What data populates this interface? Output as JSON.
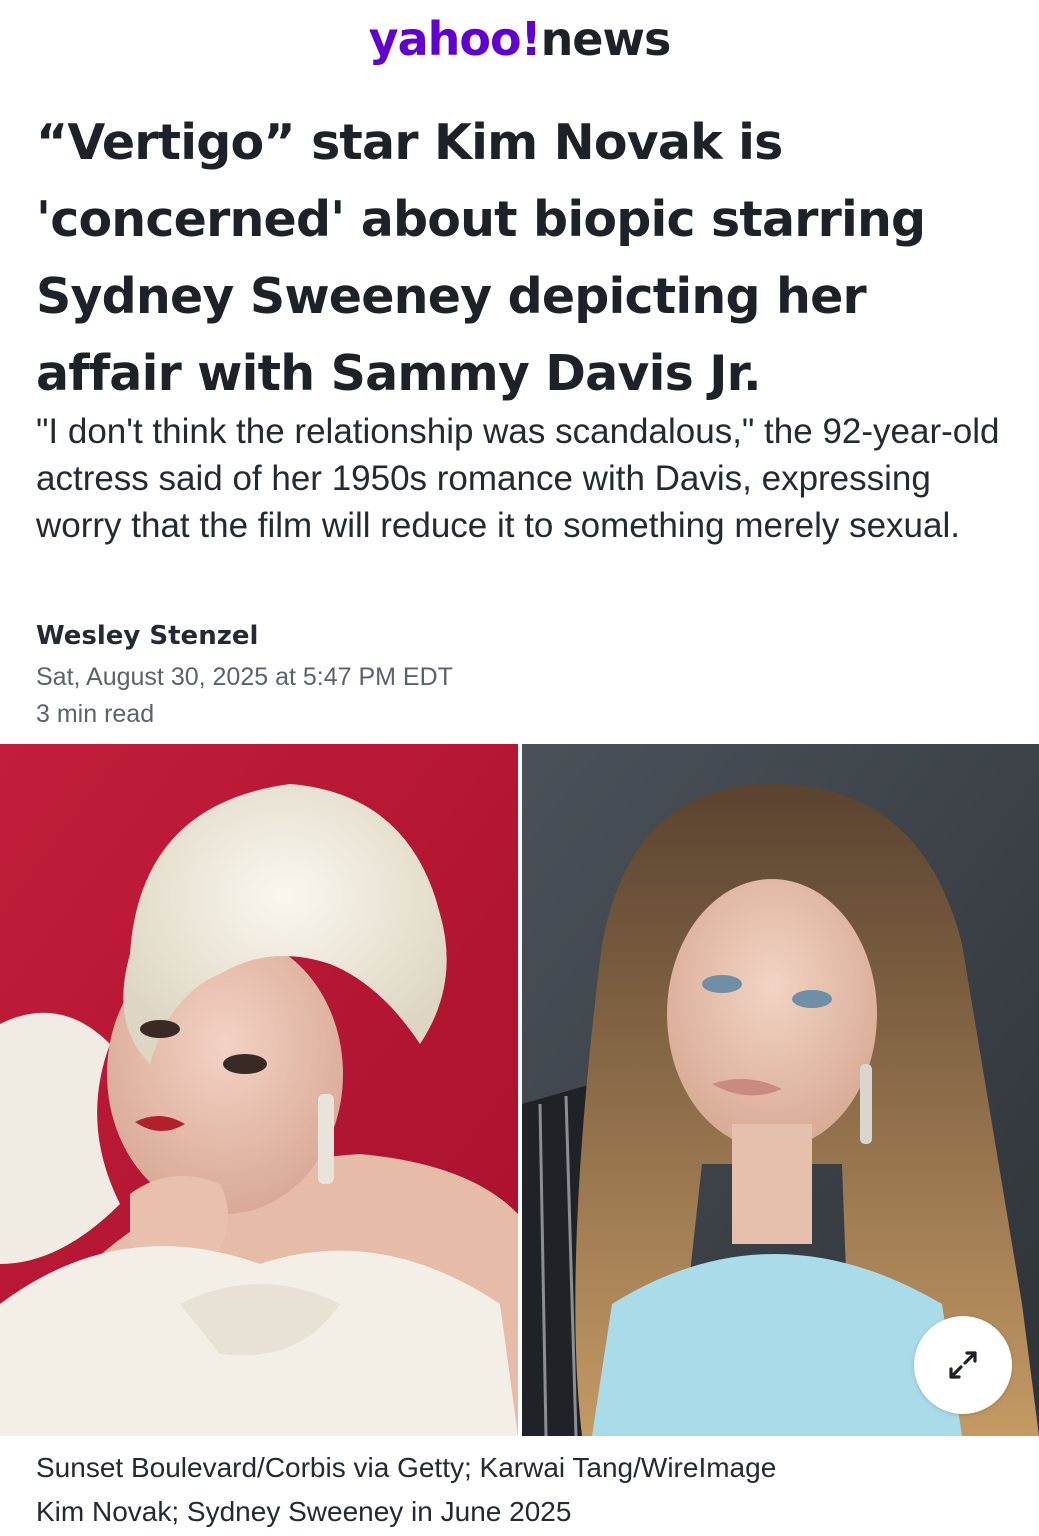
{
  "masthead": {
    "brand": "yahoo!",
    "section": "news",
    "brand_color": "#6001d2"
  },
  "article": {
    "headline": "“Vertigo” star Kim Novak is 'concerned' about biopic starring Sydney Sweeney depicting her affair with Sammy Davis Jr.",
    "dek": "\"I don't think the relationship was scandalous,\" the 92-year-old actress said of her 1950s romance with Davis, expressing worry that the film will reduce it to something merely sexual.",
    "author": "Wesley Stenzel",
    "timestamp": "Sat, August 30, 2025 at 5:47 PM EDT",
    "read_time": "3 min read"
  },
  "photo": {
    "expand_icon": "expand-arrows-icon",
    "credit": "Sunset Boulevard/Corbis via Getty; Karwai Tang/WireImage",
    "caption": "Kim Novak; Sydney Sweeney in June 2025"
  }
}
